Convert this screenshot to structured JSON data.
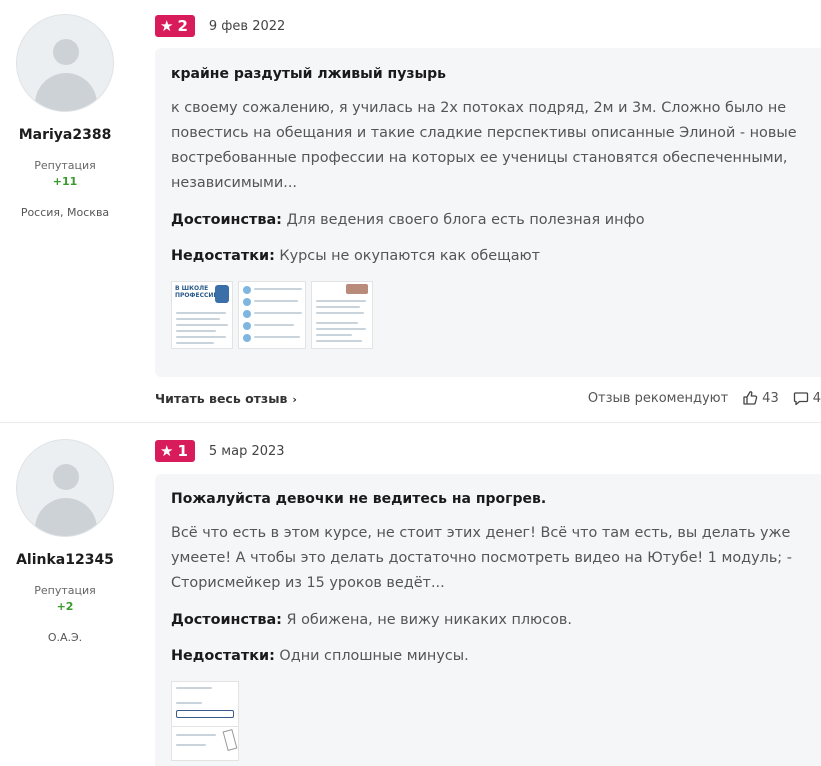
{
  "reviews": [
    {
      "user": {
        "name": "Mariya2388",
        "reputation_label": "Репутация",
        "reputation_value": "+11",
        "location": "Россия, Москва"
      },
      "rating": "2",
      "date": "9 фев 2022",
      "title": "крайне раздутый лживый пузырь",
      "text": "к своему сожалению, я училась на 2х потоках подряд, 2м и 3м. Сложно было не повестись на обещания и такие сладкие перспективы описанные Элиной - новые востребованные профессии на которых ее ученицы становятся обеспеченными, независимыми...",
      "pros_label": "Достоинства:",
      "pros": "Для ведения своего блога есть полезная инфо",
      "cons_label": "Недостатки:",
      "cons": "Курсы не окупаются как обещают",
      "thumb_heading": "В ШКОЛЕ ПРОФЕССИЙ",
      "read_more": "Читать весь отзыв",
      "recommend_label": "Отзыв рекомендуют",
      "likes": "43",
      "comments": "4"
    },
    {
      "user": {
        "name": "Alinka12345",
        "reputation_label": "Репутация",
        "reputation_value": "+2",
        "location": "О.А.Э."
      },
      "rating": "1",
      "date": "5 мар 2023",
      "title": "Пожалуйста девочки не ведитесь на прогрев.",
      "text": "Всё что есть в этом курсе, не стоит этих денег! Всё что там есть, вы делать уже умеете! А чтобы это делать достаточно посмотреть видео на Ютубе! 1 модуль; - Сторисмейкер из 15 уроков ведёт...",
      "pros_label": "Достоинства:",
      "pros": "Я обижена, не вижу никаких плюсов.",
      "cons_label": "Недостатки:",
      "cons": "Одни сплошные минусы."
    }
  ],
  "colors": {
    "rating_badge": "#d81c5b",
    "reputation": "#3a9a2e",
    "card_bg": "#f5f6f8"
  },
  "icons": {
    "rating": "star-icon",
    "like": "thumbs-up-icon",
    "comment": "comment-icon",
    "read_more": "chevron-right-icon",
    "avatar": "user-avatar-placeholder"
  }
}
